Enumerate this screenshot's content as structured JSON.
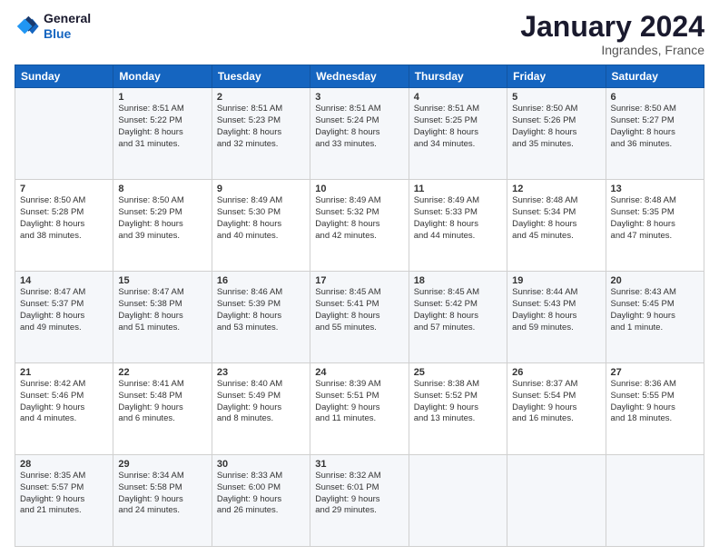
{
  "header": {
    "logo_line1": "General",
    "logo_line2": "Blue",
    "main_title": "January 2024",
    "subtitle": "Ingrandes, France"
  },
  "weekdays": [
    "Sunday",
    "Monday",
    "Tuesday",
    "Wednesday",
    "Thursday",
    "Friday",
    "Saturday"
  ],
  "weeks": [
    [
      {
        "day": "",
        "info": ""
      },
      {
        "day": "1",
        "info": "Sunrise: 8:51 AM\nSunset: 5:22 PM\nDaylight: 8 hours\nand 31 minutes."
      },
      {
        "day": "2",
        "info": "Sunrise: 8:51 AM\nSunset: 5:23 PM\nDaylight: 8 hours\nand 32 minutes."
      },
      {
        "day": "3",
        "info": "Sunrise: 8:51 AM\nSunset: 5:24 PM\nDaylight: 8 hours\nand 33 minutes."
      },
      {
        "day": "4",
        "info": "Sunrise: 8:51 AM\nSunset: 5:25 PM\nDaylight: 8 hours\nand 34 minutes."
      },
      {
        "day": "5",
        "info": "Sunrise: 8:50 AM\nSunset: 5:26 PM\nDaylight: 8 hours\nand 35 minutes."
      },
      {
        "day": "6",
        "info": "Sunrise: 8:50 AM\nSunset: 5:27 PM\nDaylight: 8 hours\nand 36 minutes."
      }
    ],
    [
      {
        "day": "7",
        "info": "Sunrise: 8:50 AM\nSunset: 5:28 PM\nDaylight: 8 hours\nand 38 minutes."
      },
      {
        "day": "8",
        "info": "Sunrise: 8:50 AM\nSunset: 5:29 PM\nDaylight: 8 hours\nand 39 minutes."
      },
      {
        "day": "9",
        "info": "Sunrise: 8:49 AM\nSunset: 5:30 PM\nDaylight: 8 hours\nand 40 minutes."
      },
      {
        "day": "10",
        "info": "Sunrise: 8:49 AM\nSunset: 5:32 PM\nDaylight: 8 hours\nand 42 minutes."
      },
      {
        "day": "11",
        "info": "Sunrise: 8:49 AM\nSunset: 5:33 PM\nDaylight: 8 hours\nand 44 minutes."
      },
      {
        "day": "12",
        "info": "Sunrise: 8:48 AM\nSunset: 5:34 PM\nDaylight: 8 hours\nand 45 minutes."
      },
      {
        "day": "13",
        "info": "Sunrise: 8:48 AM\nSunset: 5:35 PM\nDaylight: 8 hours\nand 47 minutes."
      }
    ],
    [
      {
        "day": "14",
        "info": "Sunrise: 8:47 AM\nSunset: 5:37 PM\nDaylight: 8 hours\nand 49 minutes."
      },
      {
        "day": "15",
        "info": "Sunrise: 8:47 AM\nSunset: 5:38 PM\nDaylight: 8 hours\nand 51 minutes."
      },
      {
        "day": "16",
        "info": "Sunrise: 8:46 AM\nSunset: 5:39 PM\nDaylight: 8 hours\nand 53 minutes."
      },
      {
        "day": "17",
        "info": "Sunrise: 8:45 AM\nSunset: 5:41 PM\nDaylight: 8 hours\nand 55 minutes."
      },
      {
        "day": "18",
        "info": "Sunrise: 8:45 AM\nSunset: 5:42 PM\nDaylight: 8 hours\nand 57 minutes."
      },
      {
        "day": "19",
        "info": "Sunrise: 8:44 AM\nSunset: 5:43 PM\nDaylight: 8 hours\nand 59 minutes."
      },
      {
        "day": "20",
        "info": "Sunrise: 8:43 AM\nSunset: 5:45 PM\nDaylight: 9 hours\nand 1 minute."
      }
    ],
    [
      {
        "day": "21",
        "info": "Sunrise: 8:42 AM\nSunset: 5:46 PM\nDaylight: 9 hours\nand 4 minutes."
      },
      {
        "day": "22",
        "info": "Sunrise: 8:41 AM\nSunset: 5:48 PM\nDaylight: 9 hours\nand 6 minutes."
      },
      {
        "day": "23",
        "info": "Sunrise: 8:40 AM\nSunset: 5:49 PM\nDaylight: 9 hours\nand 8 minutes."
      },
      {
        "day": "24",
        "info": "Sunrise: 8:39 AM\nSunset: 5:51 PM\nDaylight: 9 hours\nand 11 minutes."
      },
      {
        "day": "25",
        "info": "Sunrise: 8:38 AM\nSunset: 5:52 PM\nDaylight: 9 hours\nand 13 minutes."
      },
      {
        "day": "26",
        "info": "Sunrise: 8:37 AM\nSunset: 5:54 PM\nDaylight: 9 hours\nand 16 minutes."
      },
      {
        "day": "27",
        "info": "Sunrise: 8:36 AM\nSunset: 5:55 PM\nDaylight: 9 hours\nand 18 minutes."
      }
    ],
    [
      {
        "day": "28",
        "info": "Sunrise: 8:35 AM\nSunset: 5:57 PM\nDaylight: 9 hours\nand 21 minutes."
      },
      {
        "day": "29",
        "info": "Sunrise: 8:34 AM\nSunset: 5:58 PM\nDaylight: 9 hours\nand 24 minutes."
      },
      {
        "day": "30",
        "info": "Sunrise: 8:33 AM\nSunset: 6:00 PM\nDaylight: 9 hours\nand 26 minutes."
      },
      {
        "day": "31",
        "info": "Sunrise: 8:32 AM\nSunset: 6:01 PM\nDaylight: 9 hours\nand 29 minutes."
      },
      {
        "day": "",
        "info": ""
      },
      {
        "day": "",
        "info": ""
      },
      {
        "day": "",
        "info": ""
      }
    ]
  ]
}
